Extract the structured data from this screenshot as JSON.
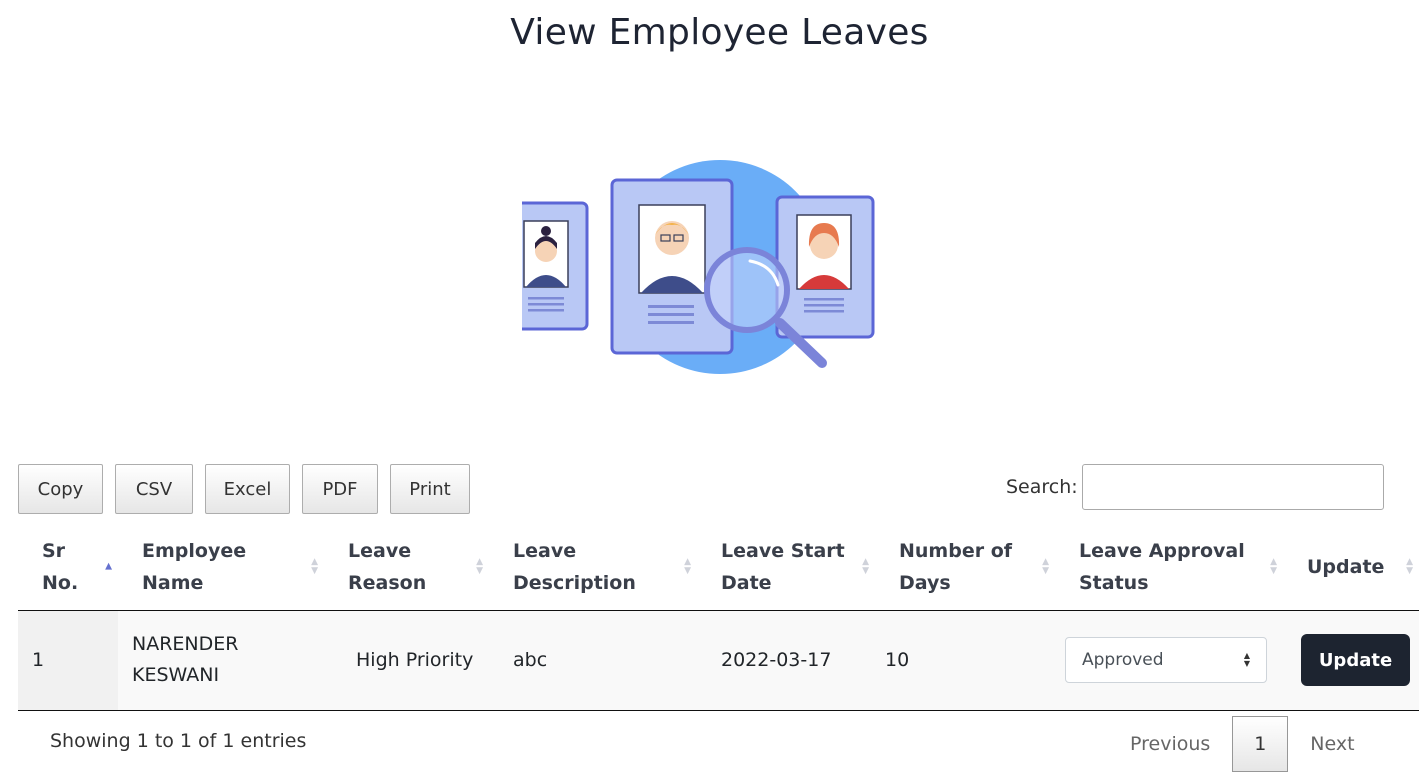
{
  "page": {
    "title": "View Employee Leaves"
  },
  "toolbar": {
    "buttons": [
      "Copy",
      "CSV",
      "Excel",
      "PDF",
      "Print"
    ],
    "search_label": "Search:",
    "search_value": ""
  },
  "table": {
    "headers": {
      "sr_line1": "Sr",
      "sr_line2": "No.",
      "name_line1": "Employee",
      "name_line2": "Name",
      "reason_line1": "Leave",
      "reason_line2": "Reason",
      "desc_line1": "Leave",
      "desc_line2": "Description",
      "start_line1": "Leave Start",
      "start_line2": "Date",
      "days_line1": "Number of",
      "days_line2": "Days",
      "status_line1": "Leave Approval",
      "status_line2": "Status",
      "update": "Update"
    },
    "rows": [
      {
        "sr": "1",
        "name_line1": "NARENDER",
        "name_line2": "KESWANI",
        "reason": "High Priority",
        "description": "abc",
        "start_date": "2022-03-17",
        "days": "10",
        "status": "Approved",
        "action": "Update"
      }
    ]
  },
  "footer": {
    "info": "Showing 1 to 1 of 1 entries",
    "prev": "Previous",
    "current_page": "1",
    "next": "Next"
  }
}
